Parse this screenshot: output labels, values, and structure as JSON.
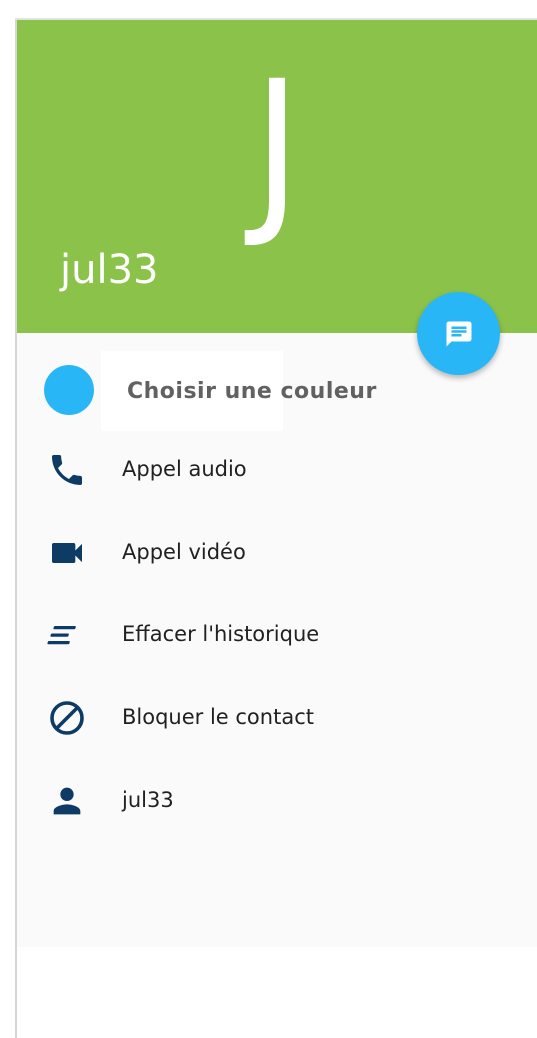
{
  "header": {
    "avatar_letter": "J",
    "name": "jul33",
    "background_color": "#8bc34a"
  },
  "fab": {
    "icon": "message-icon",
    "color": "#29b6f6"
  },
  "color_picker": {
    "label": "Choisir une couleur",
    "selected_color": "#29b6f6"
  },
  "actions": [
    {
      "label": "Appel audio",
      "icon": "phone-icon"
    },
    {
      "label": "Appel vidéo",
      "icon": "videocam-icon"
    },
    {
      "label": "Effacer l'historique",
      "icon": "clear-history-icon"
    },
    {
      "label": "Bloquer le contact",
      "icon": "block-icon"
    },
    {
      "label": "jul33",
      "icon": "person-icon"
    }
  ],
  "icon_color": "#0d3b66"
}
